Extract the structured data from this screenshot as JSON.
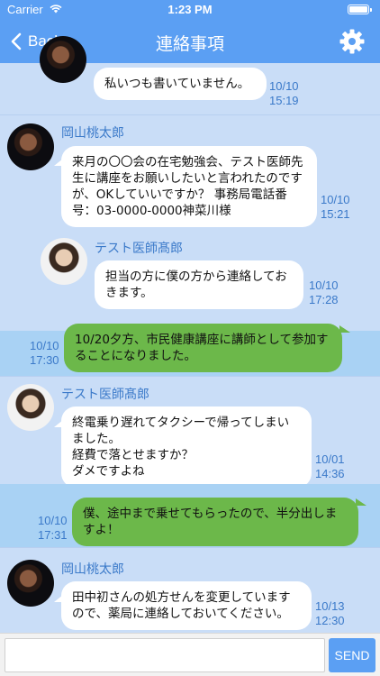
{
  "status_bar": {
    "carrier": "Carrier",
    "time": "1:23 PM"
  },
  "nav": {
    "back_label": "Back",
    "title": "連絡事項"
  },
  "messages": [
    {
      "text": "私いつも書いていません。",
      "date": "10/10",
      "time": "15:19"
    },
    {
      "sender": "岡山桃太郎",
      "text": "来月の〇〇会の在宅勉強会、テスト医師先生に講座をお願いしたいと言われたのですが、OKしていいですか？ 事務局電話番号：03-0000-0000神菜川様",
      "date": "10/10",
      "time": "15:21"
    },
    {
      "sender": "テスト医師髙郎",
      "text": "担当の方に僕の方から連絡しておきます。",
      "date": "10/10",
      "time": "17:28"
    },
    {
      "text": "10/20夕方、市民健康講座に講師として参加することになりました。",
      "date": "10/10",
      "time": "17:30"
    },
    {
      "sender": "テスト医師髙郎",
      "text": "終電乗り遅れてタクシーで帰ってしまいました。\n経費で落とせますか？\nダメですよね",
      "date": "10/01",
      "time": "14:36"
    },
    {
      "text": "僕、途中まで乗せてもらったので、半分出しますよ！",
      "date": "10/10",
      "time": "17:31"
    },
    {
      "sender": "岡山桃太郎",
      "text": "田中初さんの処方せんを変更していますので、薬局に連絡しておいてください。",
      "date": "10/13",
      "time": "12:30"
    }
  ],
  "composer": {
    "placeholder": "",
    "send_label": "SEND"
  },
  "colors": {
    "nav": "#5b9ff3",
    "background": "#a9d2f4",
    "row_light": "#c9ddf7",
    "sent_bubble": "#6cb84a",
    "accent_text": "#3a79c9"
  }
}
